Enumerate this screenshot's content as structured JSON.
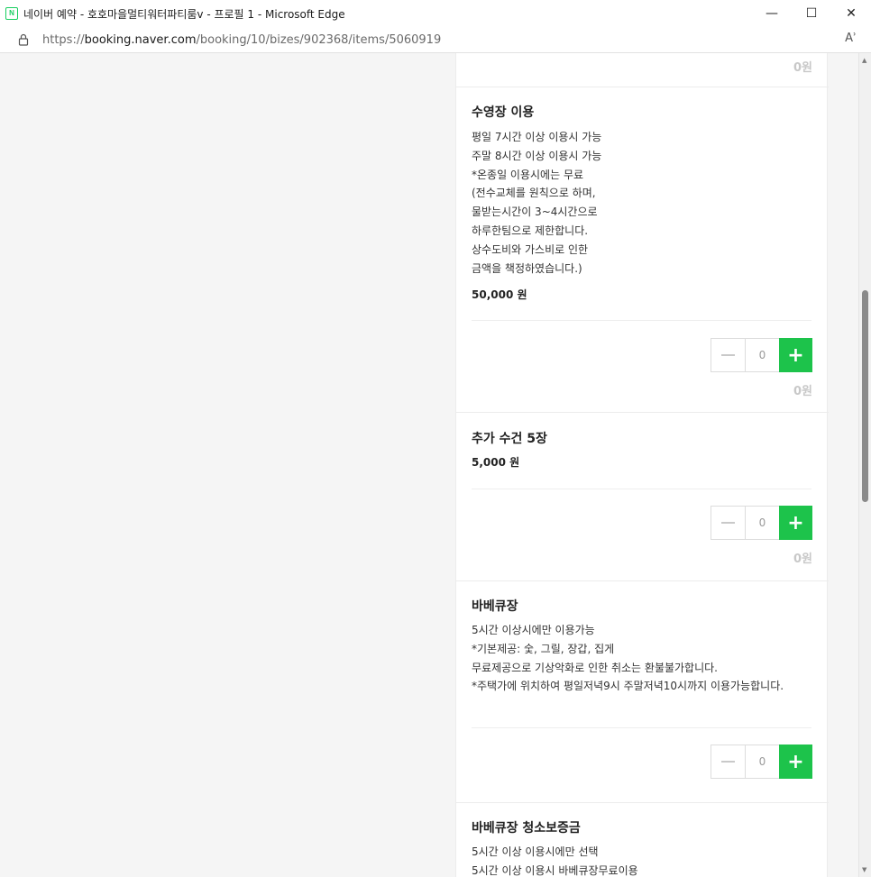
{
  "window": {
    "title": "네이버 예약 - 호호마을멀티워터파티룸v - 프로필 1 - Microsoft Edge",
    "favicon_letter": "N",
    "controls": {
      "minimize": "—",
      "maximize": "☐",
      "close": "✕"
    }
  },
  "address": {
    "scheme": "https://",
    "host": "booking.naver.com",
    "path": "/booking/10/bizes/902368/items/5060919",
    "read_aloud": "Aʾ"
  },
  "top_item": {
    "total": "0원"
  },
  "items": [
    {
      "title": "수영장 이용",
      "description": "평일 7시간 이상 이용시 가능\n주말 8시간 이상 이용시 가능\n*온종일 이용시에는 무료\n(전수교체를 원칙으로 하며,\n물받는시간이 3~4시간으로\n하루한팀으로 제한합니다.\n상수도비와 가스비로 인한\n금액을 책정하였습니다.)",
      "price": "50,000 원",
      "quantity": "0",
      "total": "0원"
    },
    {
      "title": "추가 수건 5장",
      "description": "",
      "price": "5,000 원",
      "quantity": "0",
      "total": "0원"
    },
    {
      "title": "바베큐장",
      "description": "5시간 이상시에만 이용가능\n*기본제공: 숯, 그릴, 장갑, 집게\n무료제공으로 기상악화로 인한 취소는 환불불가합니다.\n*주택가에 위치하여 평일저녁9시 주말저녁10시까지 이용가능합니다.",
      "price": "",
      "quantity": "0",
      "total": ""
    },
    {
      "title": "바베큐장 청소보증금",
      "description": "5시간 이상 이용시에만 선택\n5시간 이상 이용시 바베큐장무료이용",
      "price": "",
      "quantity": "",
      "total": ""
    }
  ],
  "stepper_icons": {
    "minus": "minus-icon",
    "plus": "+"
  },
  "colors": {
    "accent": "#1dc34b",
    "brand": "#19ce60"
  }
}
